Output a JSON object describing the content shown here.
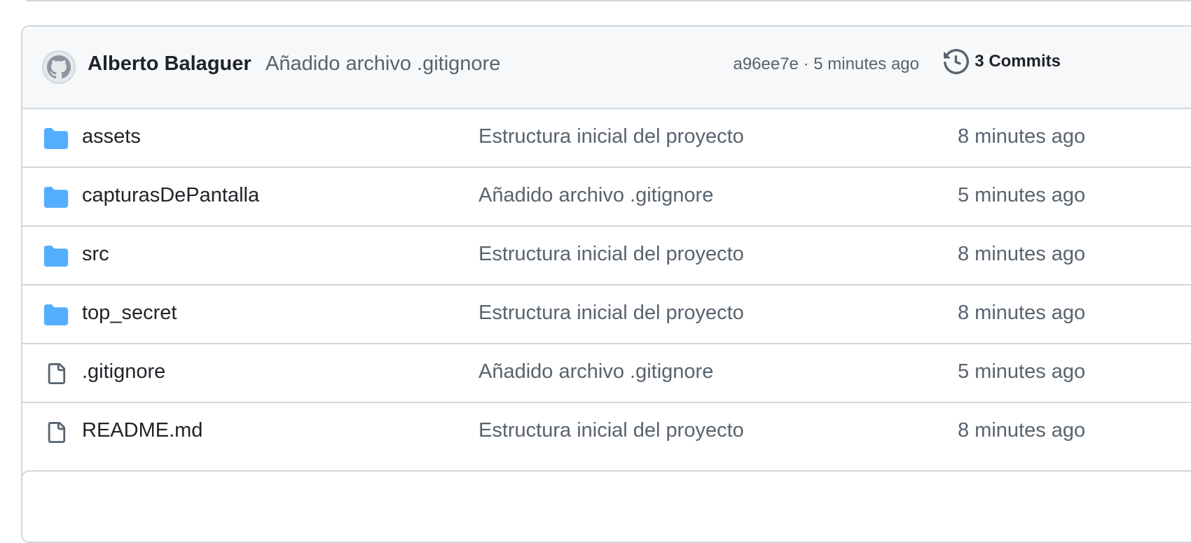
{
  "commit": {
    "author": "Alberto Balaguer",
    "message": "Añadido archivo .gitignore",
    "meta": "a96ee7e · 5 minutes ago",
    "commits_label": "3 Commits"
  },
  "colors": {
    "folder": "#54aeff",
    "file": "#59636e",
    "border": "#d0d7de",
    "header_bg": "#f6f8fa"
  },
  "files": [
    {
      "icon": "folder-icon",
      "name": "assets",
      "message": "Estructura inicial del proyecto",
      "time": "8 minutes ago"
    },
    {
      "icon": "folder-icon",
      "name": "capturasDePantalla",
      "message": "Añadido archivo .gitignore",
      "time": "5 minutes ago"
    },
    {
      "icon": "folder-icon",
      "name": "src",
      "message": "Estructura inicial del proyecto",
      "time": "8 minutes ago"
    },
    {
      "icon": "folder-icon",
      "name": "top_secret",
      "message": "Estructura inicial del proyecto",
      "time": "8 minutes ago"
    },
    {
      "icon": "file-icon",
      "name": ".gitignore",
      "message": "Añadido archivo .gitignore",
      "time": "5 minutes ago"
    },
    {
      "icon": "file-icon",
      "name": "README.md",
      "message": "Estructura inicial del proyecto",
      "time": "8 minutes ago"
    }
  ]
}
